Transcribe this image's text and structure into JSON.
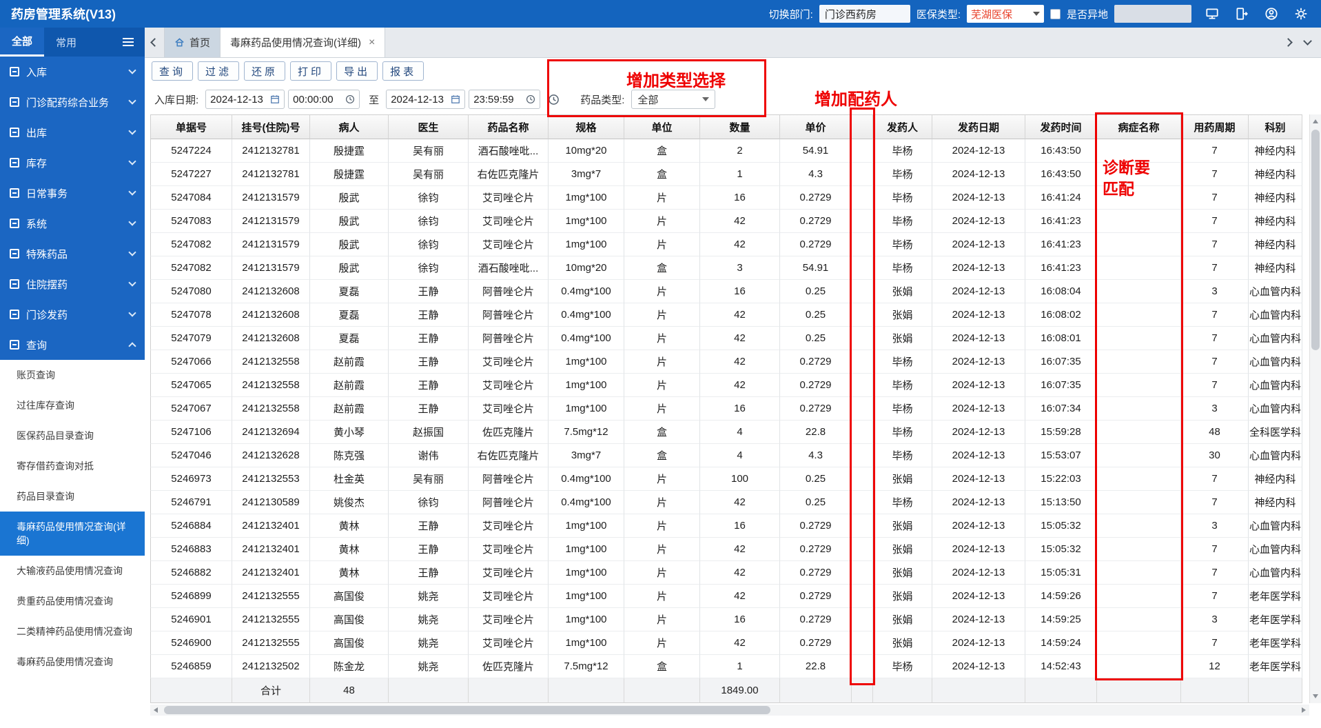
{
  "app": {
    "title": "药房管理系统(V13)"
  },
  "topbar": {
    "dept_label": "切换部门:",
    "dept_value": "门诊西药房",
    "insurance_label": "医保类型:",
    "insurance_value": "芜湖医保",
    "remote_label": "是否异地",
    "extra_value": "",
    "icons": [
      "monitor-icon",
      "logout-icon",
      "user-circle-icon",
      "settings-gear-icon"
    ]
  },
  "sidebar": {
    "tabs": [
      {
        "label": "全部",
        "active": true
      },
      {
        "label": "常用",
        "active": false
      }
    ],
    "menu": [
      {
        "label": "入库",
        "name": "inbound",
        "icon": "inbound-icon"
      },
      {
        "label": "门诊配药综合业务",
        "name": "outpatient-dispensing-business",
        "icon": "clinic-icon"
      },
      {
        "label": "出库",
        "name": "outbound",
        "icon": "outbound-icon"
      },
      {
        "label": "库存",
        "name": "inventory",
        "icon": "inventory-icon"
      },
      {
        "label": "日常事务",
        "name": "daily-affairs",
        "icon": "calendar-icon"
      },
      {
        "label": "系统",
        "name": "system",
        "icon": "gear-icon"
      },
      {
        "label": "特殊药品",
        "name": "special-drugs",
        "icon": "pill-icon"
      },
      {
        "label": "住院摆药",
        "name": "inpatient-dispensing",
        "icon": "bed-icon"
      },
      {
        "label": "门诊发药",
        "name": "outpatient-issue",
        "icon": "rx-icon"
      },
      {
        "label": "查询",
        "name": "query",
        "icon": "search-icon",
        "expanded": true
      }
    ],
    "query_submenu": [
      {
        "label": "账页查询",
        "name": "ledger-query"
      },
      {
        "label": "过往库存查询",
        "name": "past-inventory-query"
      },
      {
        "label": "医保药品目录查询",
        "name": "insurance-drug-catalog-query"
      },
      {
        "label": "寄存借药查询对抵",
        "name": "deposit-borrow-query"
      },
      {
        "label": "药品目录查询",
        "name": "drug-catalog-query"
      },
      {
        "label": "毒麻药品使用情况查询(详细)",
        "name": "narcotic-usage-detail-query"
      },
      {
        "label": "大输液药品使用情况查询",
        "name": "infusion-usage-query"
      },
      {
        "label": "贵重药品使用情况查询",
        "name": "valuable-drug-usage-query"
      },
      {
        "label": "二类精神药品使用情况查询",
        "name": "psychotropic2-usage-query"
      },
      {
        "label": "毒麻药品使用情况查询",
        "name": "narcotic-usage-query"
      }
    ],
    "selected_index": 5
  },
  "tabbar": {
    "home_tab": "首页",
    "active_tab": "毒麻药品使用情况查询(详细)",
    "close_glyph": "×"
  },
  "toolbar": {
    "buttons": [
      "查询",
      "过滤",
      "还原",
      "打印",
      "导出",
      "报表"
    ],
    "names": [
      "query",
      "filter",
      "restore",
      "print",
      "export",
      "report"
    ]
  },
  "filters": {
    "date_label": "入库日期:",
    "date_from": "2024-12-13",
    "time_from": "00:00:00",
    "to_label": "至",
    "date_to": "2024-12-13",
    "time_to": "23:59:59",
    "type_label": "药品类型:",
    "type_value": "全部"
  },
  "annotations": {
    "type_select": "增加类型选择",
    "dispenser": "增加配药人",
    "diagnosis_line1": "诊断要",
    "diagnosis_line2": "匹配"
  },
  "table": {
    "columns": [
      "单据号",
      "挂号(住院)号",
      "病人",
      "医生",
      "药品名称",
      "规格",
      "单位",
      "数量",
      "单价",
      "",
      "发药人",
      "发药日期",
      "发药时间",
      "病症名称",
      "用药周期",
      "科别"
    ],
    "rows": [
      [
        "5247224",
        "2412132781",
        "殷捷霆",
        "吴有丽",
        "酒石酸唑吡...",
        "10mg*20",
        "盒",
        "2",
        "54.91",
        "",
        "毕杨",
        "2024-12-13",
        "16:43:50",
        "",
        "7",
        "神经内科"
      ],
      [
        "5247227",
        "2412132781",
        "殷捷霆",
        "吴有丽",
        "右佐匹克隆片",
        "3mg*7",
        "盒",
        "1",
        "4.3",
        "",
        "毕杨",
        "2024-12-13",
        "16:43:50",
        "",
        "7",
        "神经内科"
      ],
      [
        "5247084",
        "2412131579",
        "殷武",
        "徐钧",
        "艾司唑仑片",
        "1mg*100",
        "片",
        "16",
        "0.2729",
        "",
        "毕杨",
        "2024-12-13",
        "16:41:24",
        "",
        "7",
        "神经内科"
      ],
      [
        "5247083",
        "2412131579",
        "殷武",
        "徐钧",
        "艾司唑仑片",
        "1mg*100",
        "片",
        "42",
        "0.2729",
        "",
        "毕杨",
        "2024-12-13",
        "16:41:23",
        "",
        "7",
        "神经内科"
      ],
      [
        "5247082",
        "2412131579",
        "殷武",
        "徐钧",
        "艾司唑仑片",
        "1mg*100",
        "片",
        "42",
        "0.2729",
        "",
        "毕杨",
        "2024-12-13",
        "16:41:23",
        "",
        "7",
        "神经内科"
      ],
      [
        "5247082",
        "2412131579",
        "殷武",
        "徐钧",
        "酒石酸唑吡...",
        "10mg*20",
        "盒",
        "3",
        "54.91",
        "",
        "毕杨",
        "2024-12-13",
        "16:41:23",
        "",
        "7",
        "神经内科"
      ],
      [
        "5247080",
        "2412132608",
        "夏磊",
        "王静",
        "阿普唑仑片",
        "0.4mg*100",
        "片",
        "16",
        "0.25",
        "",
        "张娟",
        "2024-12-13",
        "16:08:04",
        "",
        "3",
        "心血管内科"
      ],
      [
        "5247078",
        "2412132608",
        "夏磊",
        "王静",
        "阿普唑仑片",
        "0.4mg*100",
        "片",
        "42",
        "0.25",
        "",
        "张娟",
        "2024-12-13",
        "16:08:02",
        "",
        "7",
        "心血管内科"
      ],
      [
        "5247079",
        "2412132608",
        "夏磊",
        "王静",
        "阿普唑仑片",
        "0.4mg*100",
        "片",
        "42",
        "0.25",
        "",
        "张娟",
        "2024-12-13",
        "16:08:01",
        "",
        "7",
        "心血管内科"
      ],
      [
        "5247066",
        "2412132558",
        "赵前霞",
        "王静",
        "艾司唑仑片",
        "1mg*100",
        "片",
        "42",
        "0.2729",
        "",
        "毕杨",
        "2024-12-13",
        "16:07:35",
        "",
        "7",
        "心血管内科"
      ],
      [
        "5247065",
        "2412132558",
        "赵前霞",
        "王静",
        "艾司唑仑片",
        "1mg*100",
        "片",
        "42",
        "0.2729",
        "",
        "毕杨",
        "2024-12-13",
        "16:07:35",
        "",
        "7",
        "心血管内科"
      ],
      [
        "5247067",
        "2412132558",
        "赵前霞",
        "王静",
        "艾司唑仑片",
        "1mg*100",
        "片",
        "16",
        "0.2729",
        "",
        "毕杨",
        "2024-12-13",
        "16:07:34",
        "",
        "3",
        "心血管内科"
      ],
      [
        "5247106",
        "2412132694",
        "黄小琴",
        "赵振国",
        "佐匹克隆片",
        "7.5mg*12",
        "盒",
        "4",
        "22.8",
        "",
        "毕杨",
        "2024-12-13",
        "15:59:28",
        "",
        "48",
        "全科医学科"
      ],
      [
        "5247046",
        "2412132628",
        "陈克强",
        "谢伟",
        "右佐匹克隆片",
        "3mg*7",
        "盒",
        "4",
        "4.3",
        "",
        "毕杨",
        "2024-12-13",
        "15:53:07",
        "",
        "30",
        "心血管内科"
      ],
      [
        "5246973",
        "2412132553",
        "杜金英",
        "吴有丽",
        "阿普唑仑片",
        "0.4mg*100",
        "片",
        "100",
        "0.25",
        "",
        "张娟",
        "2024-12-13",
        "15:22:03",
        "",
        "7",
        "神经内科"
      ],
      [
        "5246791",
        "2412130589",
        "姚俊杰",
        "徐钧",
        "阿普唑仑片",
        "0.4mg*100",
        "片",
        "42",
        "0.25",
        "",
        "毕杨",
        "2024-12-13",
        "15:13:50",
        "",
        "7",
        "神经内科"
      ],
      [
        "5246884",
        "2412132401",
        "黄林",
        "王静",
        "艾司唑仑片",
        "1mg*100",
        "片",
        "16",
        "0.2729",
        "",
        "张娟",
        "2024-12-13",
        "15:05:32",
        "",
        "3",
        "心血管内科"
      ],
      [
        "5246883",
        "2412132401",
        "黄林",
        "王静",
        "艾司唑仑片",
        "1mg*100",
        "片",
        "42",
        "0.2729",
        "",
        "张娟",
        "2024-12-13",
        "15:05:32",
        "",
        "7",
        "心血管内科"
      ],
      [
        "5246882",
        "2412132401",
        "黄林",
        "王静",
        "艾司唑仑片",
        "1mg*100",
        "片",
        "42",
        "0.2729",
        "",
        "张娟",
        "2024-12-13",
        "15:05:31",
        "",
        "7",
        "心血管内科"
      ],
      [
        "5246899",
        "2412132555",
        "高国俊",
        "姚尧",
        "艾司唑仑片",
        "1mg*100",
        "片",
        "42",
        "0.2729",
        "",
        "张娟",
        "2024-12-13",
        "14:59:26",
        "",
        "7",
        "老年医学科"
      ],
      [
        "5246901",
        "2412132555",
        "高国俊",
        "姚尧",
        "艾司唑仑片",
        "1mg*100",
        "片",
        "16",
        "0.2729",
        "",
        "张娟",
        "2024-12-13",
        "14:59:25",
        "",
        "3",
        "老年医学科"
      ],
      [
        "5246900",
        "2412132555",
        "高国俊",
        "姚尧",
        "艾司唑仑片",
        "1mg*100",
        "片",
        "42",
        "0.2729",
        "",
        "张娟",
        "2024-12-13",
        "14:59:24",
        "",
        "7",
        "老年医学科"
      ],
      [
        "5246859",
        "2412132502",
        "陈金龙",
        "姚尧",
        "佐匹克隆片",
        "7.5mg*12",
        "盒",
        "1",
        "22.8",
        "",
        "毕杨",
        "2024-12-13",
        "14:52:43",
        "",
        "12",
        "老年医学科"
      ]
    ],
    "footer_cells": [
      "",
      "合计",
      "48",
      "",
      "",
      "",
      "",
      "1849.00",
      "",
      "",
      "",
      "",
      "",
      "",
      "",
      ""
    ]
  },
  "colors": {
    "topbar_blue": "#1464be",
    "sidebar_blue": "#1b66c2",
    "selected_item_blue": "#1a75d2",
    "annotation_red": "#ee0000",
    "insurance_text_red": "#e8432d"
  }
}
